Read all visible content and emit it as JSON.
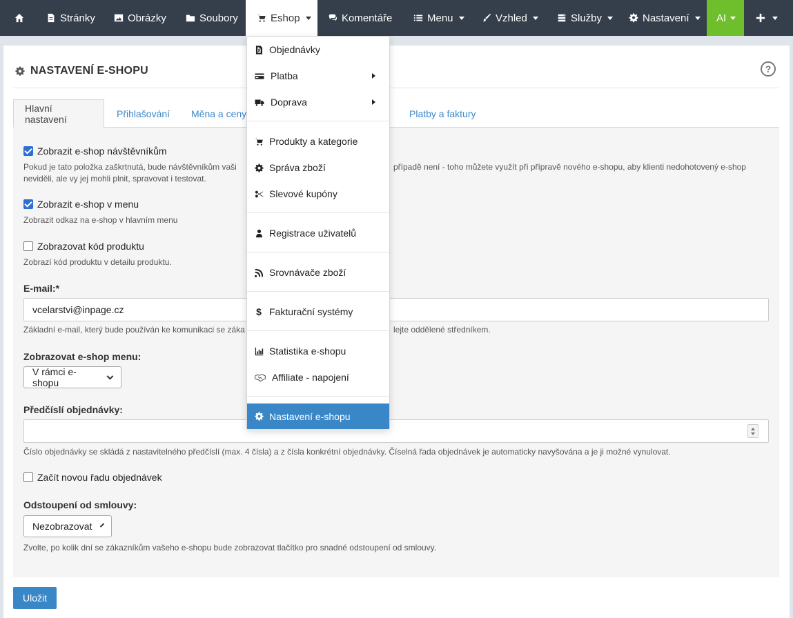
{
  "nav": {
    "home_icon": "home-icon",
    "items": [
      {
        "label": "Stránky",
        "icon": "file-icon"
      },
      {
        "label": "Obrázky",
        "icon": "image-icon"
      },
      {
        "label": "Soubory",
        "icon": "folder-icon"
      },
      {
        "label": "Eshop",
        "icon": "cart-icon"
      },
      {
        "label": "Komentáře",
        "icon": "comments-icon"
      },
      {
        "label": "Menu",
        "icon": "list-icon"
      },
      {
        "label": "Vzhled",
        "icon": "brush-icon"
      },
      {
        "label": "Služby",
        "icon": "services-icon"
      },
      {
        "label": "Nastavení",
        "icon": "gear-icon"
      },
      {
        "label": "AI",
        "icon": ""
      },
      {
        "label": "",
        "icon": "plus-icon"
      }
    ],
    "active_color": "#ffffff",
    "ai_color": "#6fbe2c",
    "bar_color": "#353f4c"
  },
  "page": {
    "title": "NASTAVENÍ E-SHOPU",
    "help": "?"
  },
  "tabs": [
    "Hlavní nastavení",
    "Přihlašování",
    "Měna a ceny",
    "Platby a faktury"
  ],
  "form": {
    "show_shop": {
      "label": "Zobrazit e-shop návštěvníkům",
      "checked": true,
      "help_line1": "Pokud je tato položka zaškrtnutá, bude návštěvníkům vaši",
      "help_line1b": "případě není - toho můžete využít při přípravě nového e-shopu, aby klienti nedohotovený e-shop",
      "help_line2": "neviděli, ale vy jej mohli plnit, spravovat i testovat."
    },
    "show_in_menu": {
      "label": "Zobrazit e-shop v menu",
      "checked": true,
      "help": "Zobrazit odkaz na e-shop v hlavním menu"
    },
    "show_code": {
      "label": "Zobrazovat kód produktu",
      "checked": false,
      "help": "Zobrazí kód produktu v detailu produktu."
    },
    "email": {
      "label": "E-mail:*",
      "value": "vcelarstvi@inpage.cz",
      "help_a": "Základní e-mail, který bude používán ke komunikaci se záka",
      "help_b": "lejte oddělené středníkem."
    },
    "menu_display": {
      "label": "Zobrazovat e-shop menu:",
      "value": "V rámci e-shopu"
    },
    "order_prefix": {
      "label": "Předčíslí objednávky:",
      "value": "",
      "help": "Číslo objednávky se skládá z nastavitelného předčíslí (max. 4 čísla) a z čísla konkrétní objednávky. Číselná řada objednávek je automaticky navyšována a je ji možné vynulovat."
    },
    "reset_series": {
      "label": "Začít novou řadu objednávek",
      "checked": false
    },
    "withdrawal": {
      "label": "Odstoupení od smlouvy:",
      "value": "Nezobrazovat",
      "help": "Zvolte, po kolik dní se zákazníkům vašeho e-shopu bude zobrazovat tlačítko pro snadné odstoupení od smlouvy."
    },
    "save": "Uložit"
  },
  "dropdown": {
    "items": [
      {
        "label": "Objednávky",
        "icon": "invoice-icon"
      },
      {
        "label": "Platba",
        "icon": "credit-card-icon"
      },
      {
        "label": "Doprava",
        "icon": "truck-icon"
      },
      {
        "label": "Produkty a kategorie",
        "icon": "cart-icon"
      },
      {
        "label": "Správa zboží",
        "icon": "gear-icon"
      },
      {
        "label": "Slevové kupóny",
        "icon": "scissors-icon"
      },
      {
        "label": "Registrace uživatelů",
        "icon": "user-icon"
      },
      {
        "label": "Srovnávače zboží",
        "icon": "rss-icon"
      },
      {
        "label": "Fakturační systémy",
        "icon": "dollar-icon"
      },
      {
        "label": "Statistika e-shopu",
        "icon": "bar-chart-icon"
      },
      {
        "label": "Affiliate - napojení",
        "icon": "handshake-icon"
      },
      {
        "label": "Nastavení e-shopu",
        "icon": "gear-icon"
      }
    ],
    "selected_color": "#3a87c8"
  }
}
